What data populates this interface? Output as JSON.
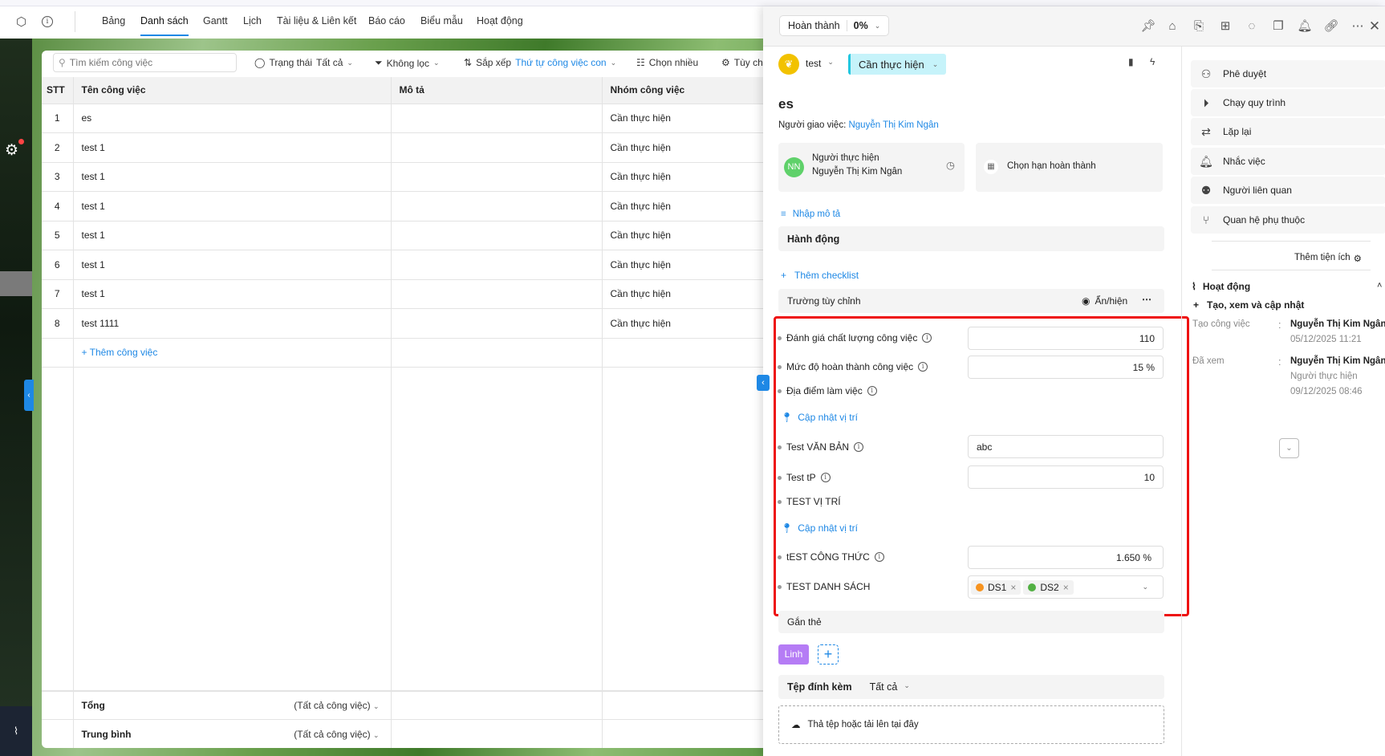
{
  "nav": {
    "tabs": [
      "Bảng",
      "Danh sách",
      "Gantt",
      "Lịch",
      "Tài liệu & Liên kết",
      "Báo cáo",
      "Biểu mẫu",
      "Hoạt động"
    ],
    "active": "Danh sách"
  },
  "toolbar": {
    "search_placeholder": "Tìm kiếm công việc",
    "status_label": "Trạng thái",
    "status_value": "Tất cả",
    "filter_label": "Không lọc",
    "sort_label": "Sắp xếp",
    "sort_value": "Thứ tự công việc con",
    "multi_select": "Chọn nhiều",
    "customize": "Tùy ch"
  },
  "table": {
    "headers": [
      "STT",
      "Tên công việc",
      "Mô tả",
      "Nhóm công việc"
    ],
    "rows": [
      [
        "1",
        "es",
        "",
        "Cần thực hiện"
      ],
      [
        "2",
        "test 1",
        "",
        "Cần thực hiện"
      ],
      [
        "3",
        "test 1",
        "",
        "Cần thực hiện"
      ],
      [
        "4",
        "test 1",
        "",
        "Cần thực hiện"
      ],
      [
        "5",
        "test 1",
        "",
        "Cần thực hiện"
      ],
      [
        "6",
        "test 1",
        "",
        "Cần thực hiện"
      ],
      [
        "7",
        "test 1",
        "",
        "Cần thực hiện"
      ],
      [
        "8",
        "test 1111",
        "",
        "Cần thực hiện"
      ]
    ],
    "add_task": "+ Thêm công việc",
    "summary": [
      {
        "label": "Tổng",
        "scope": "(Tất cả công việc)"
      },
      {
        "label": "Trung bình",
        "scope": "(Tất cả công việc)"
      }
    ]
  },
  "detail": {
    "completion_label": "Hoàn thành",
    "completion_value": "0%",
    "project": "test",
    "status": "Cần thực hiện",
    "title": "es",
    "assigner_label": "Người giao việc:",
    "assigner": "Nguyễn Thị Kim Ngân",
    "assignee_initials": "NN",
    "assignee_label": "Người thực hiện",
    "assignee": "Nguyễn Thị Kim Ngân",
    "deadline": "Chọn hạn hoàn thành",
    "description": "Nhập mô tả",
    "actions": "Hành động",
    "add_checklist": "Thêm checklist",
    "custom_fields_title": "Trường tùy chỉnh",
    "toggle_visibility": "Ẩn/hiện",
    "fields": {
      "quality": {
        "label": "Đánh giá chất lượng công việc",
        "value": "110"
      },
      "progress": {
        "label": "Mức độ hoàn thành công việc",
        "value": "15 %"
      },
      "location": {
        "label": "Địa điểm làm việc",
        "action": "Cập nhật vị trí"
      },
      "text": {
        "label": "Test VĂN BẢN",
        "value": "abc"
      },
      "tp": {
        "label": "Test tP",
        "value": "10"
      },
      "location2": {
        "label": "TEST VỊ TRÍ",
        "action": "Cập nhật vị trí"
      },
      "formula": {
        "label": "tEST CÔNG THỨC",
        "value": "1.650 %"
      },
      "list": {
        "label": "TEST DANH SÁCH",
        "chips": [
          {
            "label": "DS1",
            "color": "#f7931e"
          },
          {
            "label": "DS2",
            "color": "#52b043"
          }
        ]
      }
    },
    "tags_title": "Gắn thẻ",
    "tag": "Linh",
    "tag_color": "#b57cf5",
    "attachments_title": "Tệp đính kèm",
    "attachments_filter": "Tất cả",
    "dropzone": "Thả tệp hoặc tải lên tại đây"
  },
  "side": {
    "items": [
      "Phê duyệt",
      "Chạy quy trình",
      "Lặp lại",
      "Nhắc việc",
      "Người liên quan",
      "Quan hệ phụ thuộc"
    ],
    "add_widget": "Thêm tiện ích",
    "activity_title": "Hoạt động",
    "activity_filter": "Tạo, xem và cập nhật",
    "log": [
      {
        "action": "Tạo công việc",
        "user": "Nguyễn Thị Kim Ngân",
        "role": "",
        "time": "05/12/2025 11:21"
      },
      {
        "action": "Đã xem",
        "user": "Nguyễn Thị Kim Ngân",
        "role": "Người thực hiện",
        "time": "09/12/2025 08:46"
      }
    ]
  }
}
